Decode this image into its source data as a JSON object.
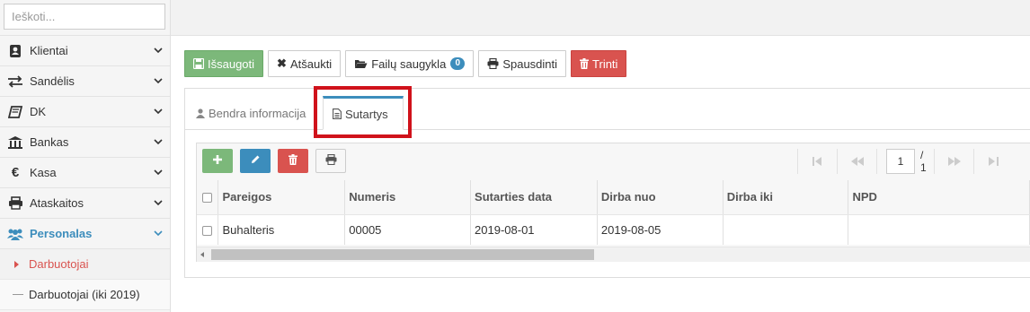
{
  "sidebar": {
    "search_placeholder": "Ieškoti...",
    "menu": [
      {
        "label": "Klientai",
        "icon": "contact-card-icon"
      },
      {
        "label": "Sandėlis",
        "icon": "exchange-arrows-icon"
      },
      {
        "label": "DK",
        "icon": "book-icon"
      },
      {
        "label": "Bankas",
        "icon": "bank-icon"
      },
      {
        "label": "Kasa",
        "icon": "euro-icon"
      },
      {
        "label": "Ataskaitos",
        "icon": "printer-icon"
      },
      {
        "label": "Personalas",
        "icon": "users-icon"
      }
    ],
    "submenu": [
      {
        "label": "Darbuotojai"
      },
      {
        "label": "Darbuotojai (iki 2019)"
      }
    ]
  },
  "toolbar": {
    "save_label": "Išsaugoti",
    "cancel_label": "Atšaukti",
    "files_label": "Failų saugykla",
    "files_count": "0",
    "print_label": "Spausdinti",
    "delete_label": "Trinti"
  },
  "tabs": [
    {
      "label": "Bendra informacija",
      "active": false
    },
    {
      "label": "Sutartys",
      "active": true
    }
  ],
  "grid": {
    "columns": [
      "Pareigos",
      "Numeris",
      "Sutarties data",
      "Dirba nuo",
      "Dirba iki",
      "NPD"
    ],
    "rows": [
      [
        "Buhalteris",
        "00005",
        "2019-08-01",
        "2019-08-05",
        "",
        ""
      ]
    ],
    "pager": {
      "current_page": "1",
      "total_pages": "/ 1"
    }
  },
  "colors": {
    "success": "#7cb87a",
    "primary": "#3c8dbc",
    "danger": "#d9534f",
    "highlight": "#d0121b"
  }
}
